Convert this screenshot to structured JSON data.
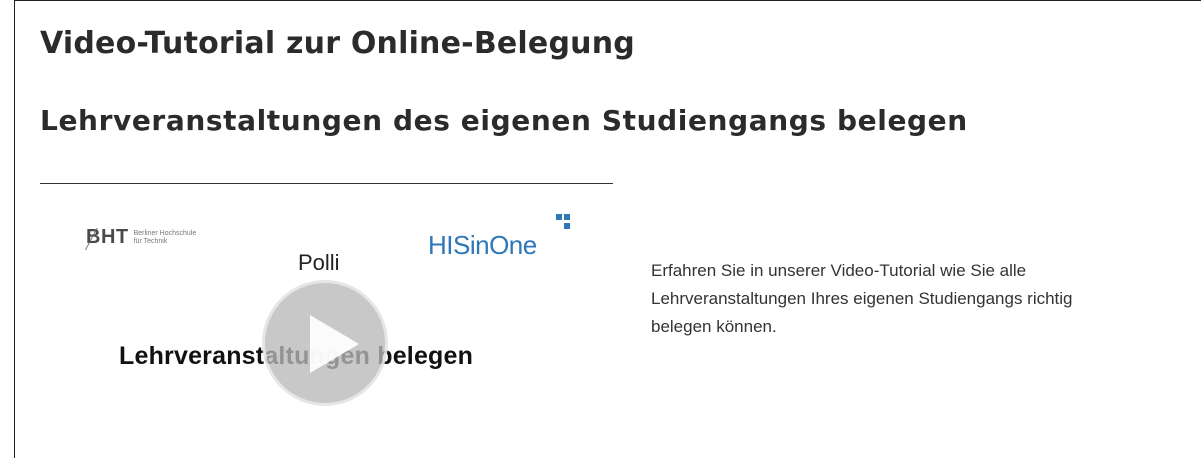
{
  "page": {
    "heading": "Video-Tutorial zur Online-Belegung",
    "subheading": "Lehrveranstaltungen des eigenen Studiengangs belegen"
  },
  "video": {
    "bht_logo": "BHT",
    "bht_subtitle_line1": "Berliner Hochschule",
    "bht_subtitle_line2": "für Technik",
    "app_name": "Polli",
    "partner_logo": "HISinOne",
    "title": "Lehrveranstaltungen belegen",
    "play_icon": "play-icon"
  },
  "description": {
    "line1": "Erfahren Sie in unserer Video-Tutorial wie Sie alle",
    "line2": "Lehrveranstaltungen Ihres eigenen Studiengangs richtig",
    "line3": "belegen können."
  },
  "colors": {
    "heading": "#2b2b2b",
    "his_blue": "#2e78b8",
    "play_overlay": "#b9b9b9"
  }
}
